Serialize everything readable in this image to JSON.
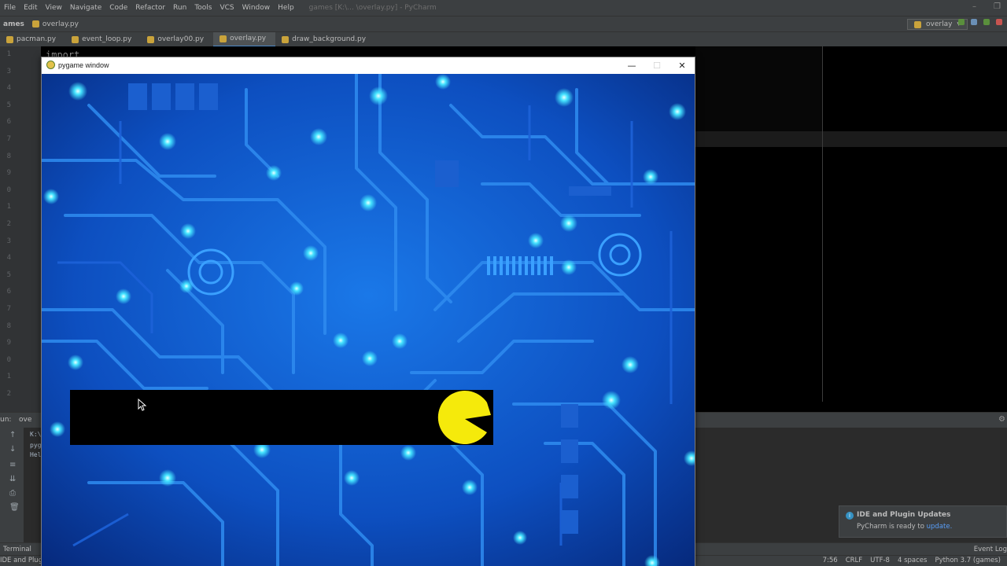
{
  "ide": {
    "menu": [
      "File",
      "Edit",
      "View",
      "Navigate",
      "Code",
      "Refactor",
      "Run",
      "Tools",
      "VCS",
      "Window",
      "Help"
    ],
    "title": "games [K:\\... \\overlay.py] - PyCharm",
    "breadcrumb": [
      "ames",
      "overlay.py"
    ],
    "run_config": "overlay",
    "tabs": [
      {
        "label": "pacman.py",
        "active": false
      },
      {
        "label": "event_loop.py",
        "active": false
      },
      {
        "label": "overlay00.py",
        "active": false
      },
      {
        "label": "overlay.py",
        "active": true
      },
      {
        "label": "draw_background.py",
        "active": false
      }
    ],
    "gutter_lines": [
      "1",
      "3",
      "4",
      "5",
      "6",
      "7",
      "8",
      "9",
      "0",
      "1",
      "2",
      "3",
      "4",
      "5",
      "6",
      "7",
      "8",
      "9",
      "0",
      "1",
      "2"
    ],
    "editor_fragment": "import",
    "run_panel": {
      "label": "un:",
      "tab": "ove",
      "console": [
        "K:\\",
        "pyg",
        "Hel"
      ]
    },
    "bottom_tabs": {
      "terminal": "Terminal",
      "event_log": "Event Log"
    },
    "status": {
      "message": "IDE and Plugin U",
      "position": "7:56",
      "line_sep": "CRLF",
      "encoding": "UTF-8",
      "indent": "4 spaces",
      "interpreter": "Python 3.7 (games)"
    },
    "notification": {
      "title": "IDE and Plugin Updates",
      "message": "PyCharm is ready to",
      "link": "update."
    }
  },
  "pygame": {
    "title": "pygame window",
    "controls": {
      "minimize": "—",
      "maximize": "☐",
      "close": "✕"
    },
    "sprite": "pacman",
    "colors": {
      "pacman": "#f5ea0b",
      "overlay": "#000000",
      "circuit_glow": "#35e0ff",
      "circuit_base": "#0b3ea8"
    }
  }
}
